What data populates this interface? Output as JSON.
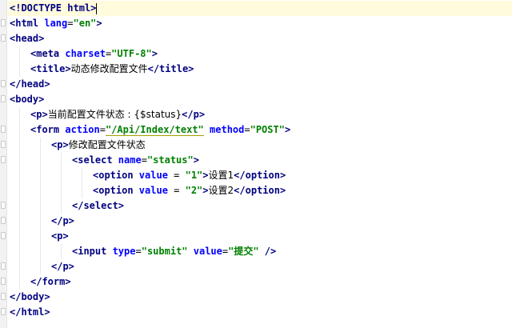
{
  "editor": {
    "lines": [
      {
        "segments": [
          {
            "t": "<!DOCTYPE html>",
            "c": "tn"
          }
        ]
      },
      {
        "segments": [
          {
            "t": "<html ",
            "c": "tn"
          },
          {
            "t": "lang",
            "c": "an"
          },
          {
            "t": "=",
            "c": "pl"
          },
          {
            "t": "\"en\"",
            "c": "av"
          },
          {
            "t": ">",
            "c": "tn"
          }
        ]
      },
      {
        "segments": [
          {
            "t": "<head>",
            "c": "tn"
          }
        ]
      },
      {
        "segments": [
          {
            "t": "<meta ",
            "c": "tn"
          },
          {
            "t": "charset",
            "c": "an"
          },
          {
            "t": "=",
            "c": "pl"
          },
          {
            "t": "\"UTF-8\"",
            "c": "av"
          },
          {
            "t": ">",
            "c": "tn"
          }
        ]
      },
      {
        "segments": [
          {
            "t": "<title>",
            "c": "tn"
          },
          {
            "t": "动态修改配置文件",
            "c": "txt"
          },
          {
            "t": "</title>",
            "c": "tn"
          }
        ]
      },
      {
        "segments": [
          {
            "t": "</head>",
            "c": "tn"
          }
        ]
      },
      {
        "segments": [
          {
            "t": "<body>",
            "c": "tn"
          }
        ]
      },
      {
        "segments": [
          {
            "t": "<p>",
            "c": "tn"
          },
          {
            "t": "当前配置文件状态 : {$status}",
            "c": "txt"
          },
          {
            "t": "</p>",
            "c": "tn"
          }
        ]
      },
      {
        "segments": [
          {
            "t": "<form ",
            "c": "tn"
          },
          {
            "t": "action",
            "c": "an"
          },
          {
            "t": "=",
            "c": "pl"
          },
          {
            "t": "\"/Api/Index/text\"",
            "c": "av ul"
          },
          {
            "t": " ",
            "c": "pl"
          },
          {
            "t": "method",
            "c": "an"
          },
          {
            "t": "=",
            "c": "pl"
          },
          {
            "t": "\"POST\"",
            "c": "av"
          },
          {
            "t": ">",
            "c": "tn"
          }
        ]
      },
      {
        "segments": [
          {
            "t": "<p>",
            "c": "tn"
          },
          {
            "t": "修改配置文件状态",
            "c": "txt"
          }
        ]
      },
      {
        "segments": [
          {
            "t": "<select ",
            "c": "tn"
          },
          {
            "t": "name",
            "c": "an"
          },
          {
            "t": "=",
            "c": "pl"
          },
          {
            "t": "\"status\"",
            "c": "av"
          },
          {
            "t": ">",
            "c": "tn"
          }
        ]
      },
      {
        "segments": [
          {
            "t": "<option ",
            "c": "tn"
          },
          {
            "t": "value",
            "c": "an"
          },
          {
            "t": " = ",
            "c": "pl"
          },
          {
            "t": "\"1\"",
            "c": "av"
          },
          {
            "t": ">",
            "c": "tn"
          },
          {
            "t": "设置1",
            "c": "txt"
          },
          {
            "t": "</option>",
            "c": "tn"
          }
        ]
      },
      {
        "segments": [
          {
            "t": "<option ",
            "c": "tn"
          },
          {
            "t": "value",
            "c": "an"
          },
          {
            "t": " = ",
            "c": "pl"
          },
          {
            "t": "\"2\"",
            "c": "av"
          },
          {
            "t": ">",
            "c": "tn"
          },
          {
            "t": "设置2",
            "c": "txt"
          },
          {
            "t": "</option>",
            "c": "tn"
          }
        ]
      },
      {
        "segments": [
          {
            "t": "</select>",
            "c": "tn"
          }
        ]
      },
      {
        "segments": [
          {
            "t": "</p>",
            "c": "tn"
          }
        ]
      },
      {
        "segments": [
          {
            "t": "<p>",
            "c": "tn"
          }
        ]
      },
      {
        "segments": [
          {
            "t": "<input ",
            "c": "tn"
          },
          {
            "t": "type",
            "c": "an"
          },
          {
            "t": "=",
            "c": "pl"
          },
          {
            "t": "\"submit\"",
            "c": "av"
          },
          {
            "t": " ",
            "c": "pl"
          },
          {
            "t": "value",
            "c": "an"
          },
          {
            "t": "=",
            "c": "pl"
          },
          {
            "t": "\"提交\"",
            "c": "av"
          },
          {
            "t": " />",
            "c": "tn"
          }
        ]
      },
      {
        "segments": [
          {
            "t": "</p>",
            "c": "tn"
          }
        ]
      },
      {
        "segments": [
          {
            "t": "</form>",
            "c": "tn"
          }
        ]
      },
      {
        "segments": [
          {
            "t": "</body>",
            "c": "tn"
          }
        ]
      },
      {
        "segments": [
          {
            "t": "</html>",
            "c": "tn"
          }
        ]
      }
    ]
  }
}
